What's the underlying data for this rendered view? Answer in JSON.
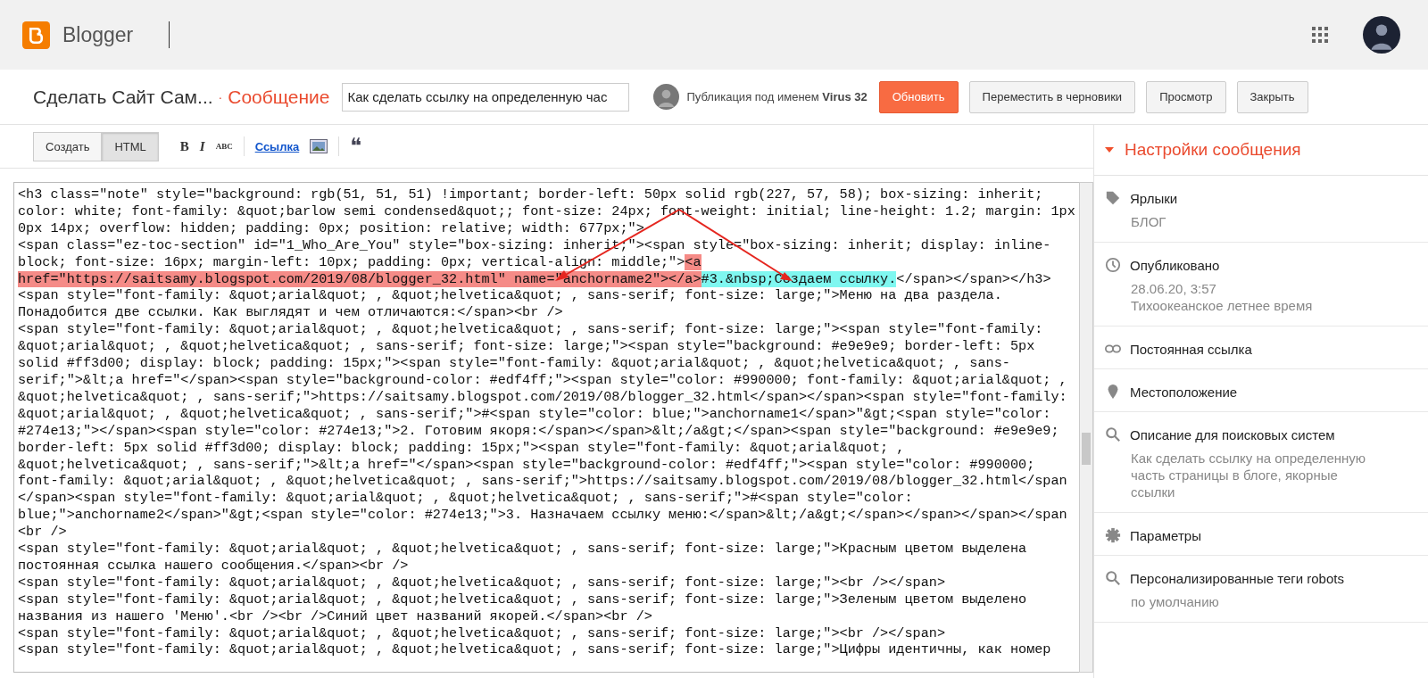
{
  "app": {
    "name": "Blogger"
  },
  "header": {
    "blog_title": "Сделать Сайт Сам...",
    "separator": "·",
    "section": "Сообщение",
    "title_field": {
      "value": "Как сделать ссылку на определенную час"
    },
    "author": "Публикация под именем **Virus 32**",
    "buttons": [
      {
        "label": "Обновить",
        "kind": "primary"
      },
      {
        "label": "Переместить в черновики",
        "kind": "plain"
      },
      {
        "label": "Просмотр",
        "kind": "plain"
      },
      {
        "label": "Закрыть",
        "kind": "plain"
      }
    ]
  },
  "toolbar": {
    "tabs": [
      {
        "label": "Создать",
        "selected": false
      },
      {
        "label": "HTML",
        "selected": true
      }
    ],
    "tools": [
      {
        "kind": "bold",
        "label": "B"
      },
      {
        "kind": "italic",
        "label": "I"
      },
      {
        "kind": "strike",
        "label": "ABC"
      },
      {
        "kind": "link",
        "label": "Ссылка"
      },
      {
        "kind": "image"
      },
      {
        "kind": "quote",
        "label": "❝"
      }
    ]
  },
  "code_lines": [
    [
      {
        "text": "<h3 class=\"note\" style=\"background: rgb(51, 51, 51) !important; border-left: 50px solid rgb(227, 57, 58); box-sizing: inherit;"
      }
    ],
    [
      {
        "text": "color: white; font-family: &quot;barlow semi condensed&quot;; font-size: 24px; font-weight: initial; line-height: 1.2; margin: 1px"
      }
    ],
    [
      {
        "text": "0px 14px; overflow: hidden; padding: 0px; position: relative; width: 677px;\">"
      }
    ],
    [
      {
        "text": "<span class=\"ez-toc-section\" id=\"1_Who_Are_You\" style=\"box-sizing: inherit;\"><span style=\"box-sizing: inherit; display: inline-"
      }
    ],
    [
      {
        "text": "block; font-size: 16px; margin-left: 10px; padding: 0px; vertical-align: middle;\">"
      },
      {
        "text": "<a",
        "color": "#f58b87"
      }
    ],
    [
      {
        "text": "href=\"https://saitsamy.blogspot.com/2019/08/blogger_32.html\" name=\"anchorname2\"></a>",
        "color": "#f58b87"
      },
      {
        "text": "#3.&nbsp;Создаем ссылку.",
        "color": "#7ff7f0"
      },
      {
        "text": "</span></span></h3>"
      }
    ],
    [
      {
        "text": "<span style=\"font-family: &quot;arial&quot; , &quot;helvetica&quot; , sans-serif; font-size: large;\">Меню на два раздела."
      }
    ],
    [
      {
        "text": "Понадобится две ссылки. Как выглядят и чем отличаются:</span><br />"
      }
    ],
    [
      {
        "text": "<span style=\"font-family: &quot;arial&quot; , &quot;helvetica&quot; , sans-serif; font-size: large;\"><span style=\"font-family:"
      }
    ],
    [
      {
        "text": "&quot;arial&quot; , &quot;helvetica&quot; , sans-serif; font-size: large;\"><span style=\"background: #e9e9e9; border-left: 5px"
      }
    ],
    [
      {
        "text": "solid #ff3d00; display: block; padding: 15px;\"><span style=\"font-family: &quot;arial&quot; , &quot;helvetica&quot; , sans-"
      }
    ],
    [
      {
        "text": "serif;\">&lt;a href=\"</span><span style=\"background-color: #edf4ff;\"><span style=\"color: #990000; font-family: &quot;arial&quot; ,"
      }
    ],
    [
      {
        "text": "&quot;helvetica&quot; , sans-serif;\">https://saitsamy.blogspot.com/2019/08/blogger_32.html</span></span><span style=\"font-family:"
      }
    ],
    [
      {
        "text": "&quot;arial&quot; , &quot;helvetica&quot; , sans-serif;\">#<span style=\"color: blue;\">anchorname1</span>\"&gt;<span style=\"color:"
      }
    ],
    [
      {
        "text": "#274e13;\"></span><span style=\"color: #274e13;\">2. Готовим якоря:</span></span>&lt;/a&gt;</span><span style=\"background: #e9e9e9;"
      }
    ],
    [
      {
        "text": "border-left: 5px solid #ff3d00; display: block; padding: 15px;\"><span style=\"font-family: &quot;arial&quot; ,"
      }
    ],
    [
      {
        "text": "&quot;helvetica&quot; , sans-serif;\">&lt;a href=\"</span><span style=\"background-color: #edf4ff;\"><span style=\"color: #990000;"
      }
    ],
    [
      {
        "text": "font-family: &quot;arial&quot; , &quot;helvetica&quot; , sans-serif;\">https://saitsamy.blogspot.com/2019/08/blogger_32.html</span"
      }
    ],
    [
      {
        "text": "</span><span style=\"font-family: &quot;arial&quot; , &quot;helvetica&quot; , sans-serif;\">#<span style=\"color:"
      }
    ],
    [
      {
        "text": "blue;\">anchorname2</span>\"&gt;<span style=\"color: #274e13;\">3. Назначаем ссылку меню:</span>&lt;/a&gt;</span></span></span></span"
      }
    ],
    [
      {
        "text": "<br />"
      }
    ],
    [
      {
        "text": "<span style=\"font-family: &quot;arial&quot; , &quot;helvetica&quot; , sans-serif; font-size: large;\">Красным цветом выделена"
      }
    ],
    [
      {
        "text": "постоянная ссылка нашего сообщения.</span><br />"
      }
    ],
    [
      {
        "text": "<span style=\"font-family: &quot;arial&quot; , &quot;helvetica&quot; , sans-serif; font-size: large;\"><br /></span>"
      }
    ],
    [
      {
        "text": "<span style=\"font-family: &quot;arial&quot; , &quot;helvetica&quot; , sans-serif; font-size: large;\">Зеленым цветом выделено"
      }
    ],
    [
      {
        "text": "названия из нашего 'Меню'.<br /><br />Синий цвет названий якорей.</span><br />"
      }
    ],
    [
      {
        "text": "<span style=\"font-family: &quot;arial&quot; , &quot;helvetica&quot; , sans-serif; font-size: large;\"><br /></span>"
      }
    ],
    [
      {
        "text": "<span style=\"font-family: &quot;arial&quot; , &quot;helvetica&quot; , sans-serif; font-size: large;\">Цифры идентичны, как номер"
      }
    ]
  ],
  "sidebar": {
    "title": "Настройки сообщения",
    "expanded": true,
    "items": [
      {
        "kind": "tag",
        "label": "Ярлыки",
        "details": [
          "БЛОГ"
        ]
      },
      {
        "kind": "clock",
        "label": "Опубликовано",
        "details": [
          "28.06.20, 3:57",
          "Тихоокеанское летнее время"
        ]
      },
      {
        "kind": "link",
        "label": "Постоянная ссылка"
      },
      {
        "kind": "pin",
        "label": "Местоположение"
      },
      {
        "kind": "search",
        "label": "Описание для поисковых систем",
        "details": [
          "Как сделать ссылку на определенную часть страницы в блоге, якорные ссылки"
        ]
      },
      {
        "kind": "gear",
        "label": "Параметры"
      },
      {
        "kind": "search",
        "label": "Персонализированные теги robots",
        "details": [
          "по умолчанию"
        ]
      }
    ]
  }
}
